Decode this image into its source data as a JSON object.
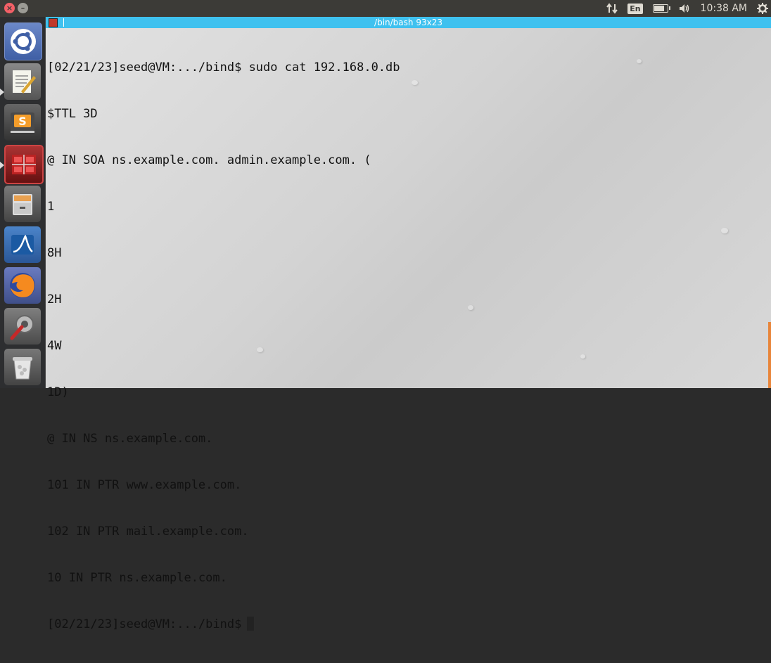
{
  "top_panel": {
    "window_controls": {
      "close_glyph": "×",
      "minimize_glyph": "–"
    },
    "indicators": {
      "network_icon": "updown-arrows-icon",
      "language": "En",
      "battery_icon": "battery-icon",
      "volume_icon": "speaker-icon",
      "time": "10:38 AM",
      "settings_icon": "gear-icon"
    }
  },
  "launcher": {
    "items": [
      {
        "name": "ubuntu-dash",
        "icon": "ubuntu-logo-icon"
      },
      {
        "name": "text-editor",
        "icon": "text-editor-icon"
      },
      {
        "name": "sublime-text",
        "icon": "sublime-icon"
      },
      {
        "name": "terminal",
        "icon": "terminal-icon"
      },
      {
        "name": "files",
        "icon": "file-cabinet-icon"
      },
      {
        "name": "wireshark",
        "icon": "wireshark-fin-icon"
      },
      {
        "name": "firefox",
        "icon": "firefox-icon"
      },
      {
        "name": "system-settings",
        "icon": "tools-icon"
      },
      {
        "name": "trash",
        "icon": "trash-icon"
      }
    ]
  },
  "terminal": {
    "title": "/bin/bash 93x23",
    "lines": [
      "[02/21/23]seed@VM:.../bind$ sudo cat 192.168.0.db",
      "$TTL 3D",
      "@ IN SOA ns.example.com. admin.example.com. (",
      "1",
      "8H",
      "2H",
      "4W",
      "1D)",
      "@ IN NS ns.example.com.",
      "101 IN PTR www.example.com.",
      "102 IN PTR mail.example.com.",
      "10 IN PTR ns.example.com."
    ],
    "prompt": "[02/21/23]seed@VM:.../bind$"
  },
  "colors": {
    "titlebar": "#3fc1ef",
    "panel": "#3c3b37",
    "accent": "#e8853a"
  }
}
